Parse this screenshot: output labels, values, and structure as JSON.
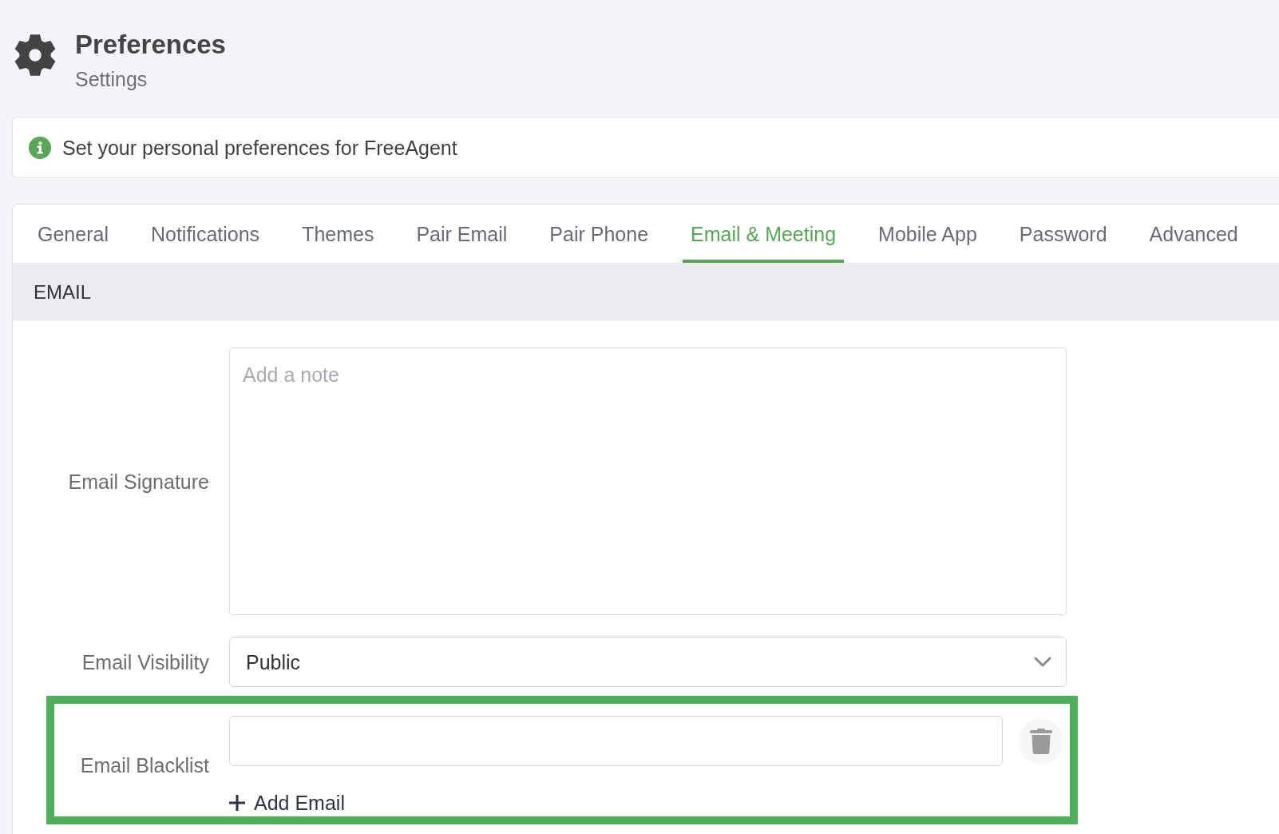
{
  "header": {
    "title": "Preferences",
    "subtitle": "Settings"
  },
  "info_banner": {
    "text": "Set your personal preferences for FreeAgent"
  },
  "tabs": [
    {
      "label": "General",
      "selected": false
    },
    {
      "label": "Notifications",
      "selected": false
    },
    {
      "label": "Themes",
      "selected": false
    },
    {
      "label": "Pair Email",
      "selected": false
    },
    {
      "label": "Pair Phone",
      "selected": false
    },
    {
      "label": "Email & Meeting",
      "selected": true
    },
    {
      "label": "Mobile App",
      "selected": false
    },
    {
      "label": "Password",
      "selected": false
    },
    {
      "label": "Advanced",
      "selected": false
    }
  ],
  "section": {
    "title": "EMAIL",
    "fields": [
      {
        "kind": "textarea",
        "label": "Email Signature",
        "placeholder": "Add a note",
        "highlighted": false
      },
      {
        "kind": "select",
        "label": "Email Visibility",
        "value": "Public",
        "highlighted": false
      },
      {
        "kind": "email_list",
        "label": "Email Blacklist",
        "add_label": "Add Email",
        "highlighted": true
      }
    ]
  }
}
